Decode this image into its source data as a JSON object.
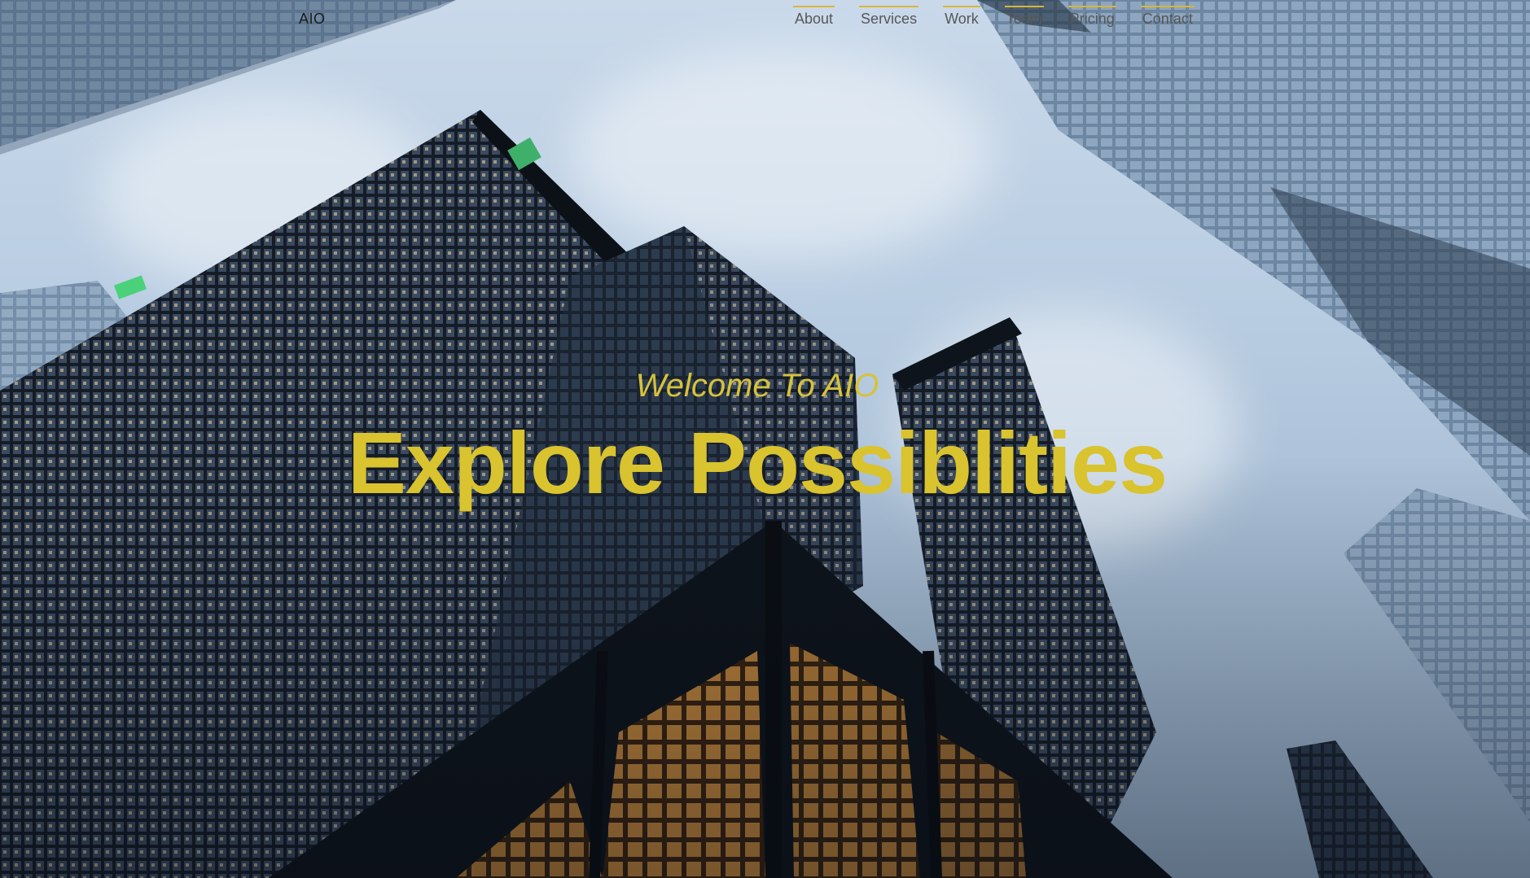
{
  "brand": "AIO",
  "nav": {
    "items": [
      {
        "label": "About"
      },
      {
        "label": "Services"
      },
      {
        "label": "Work"
      },
      {
        "label": "Team"
      },
      {
        "label": "Pricing"
      },
      {
        "label": "Contact"
      }
    ],
    "accent_color": "#d9b53a"
  },
  "hero": {
    "subtitle": "Welcome To AIO",
    "title": "Explore Possiblities",
    "text_color": "#d9c32e",
    "background": "skyscrapers-looking-up-photo"
  }
}
